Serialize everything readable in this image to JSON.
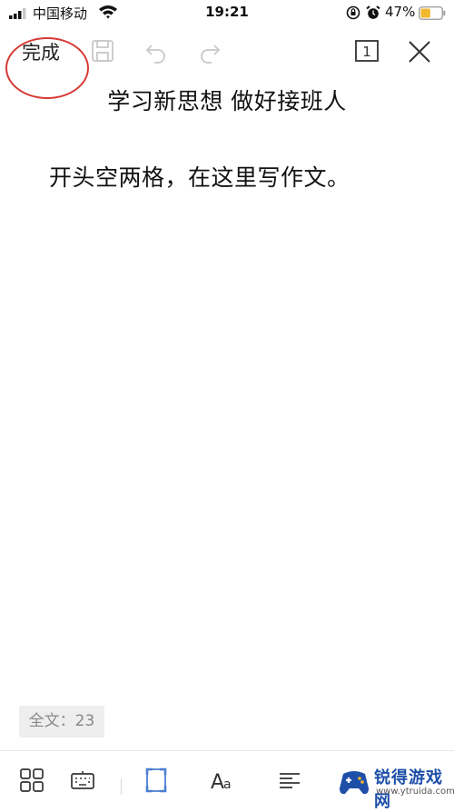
{
  "status_bar": {
    "carrier": "中国移动",
    "time": "19:21",
    "battery": "47%",
    "battery_level": 0.47
  },
  "toolbar": {
    "done_label": "完成",
    "page_number": "1"
  },
  "document": {
    "title": "学习新思想  做好接班人",
    "body": "开头空两格，在这里写作文。"
  },
  "footer": {
    "word_count": "全文：23"
  },
  "watermark": {
    "title": "锐得游戏网",
    "url": "www.ytruida.com"
  },
  "colors": {
    "accent": "#4a7fd1",
    "annotation": "#d63a35",
    "watermark": "#1d4fa8"
  }
}
